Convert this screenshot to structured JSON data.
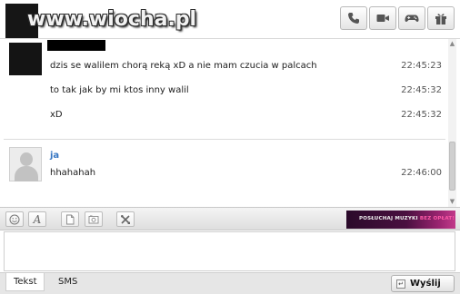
{
  "watermark": "www.wiocha.pl",
  "conversation": {
    "messages_other": [
      {
        "text": "dzis se walilem chorą reką xD a nie mam czucia w palcach",
        "time": "22:45:23"
      },
      {
        "text": "to tak jak by mi ktos inny walil",
        "time": "22:45:32"
      },
      {
        "text": "xD",
        "time": "22:45:32"
      }
    ],
    "me": {
      "name": "ja",
      "message": {
        "text": "hhahahah",
        "time": "22:46:00"
      }
    }
  },
  "toolbar": {
    "banner_text": "POSŁUCHAJ MUZYKI",
    "banner_highlight": "BEZ OPŁAT!"
  },
  "input": {
    "placeholder": "",
    "value": ""
  },
  "tabs": {
    "text": "Tekst",
    "sms": "SMS"
  },
  "send_label": "Wyślij",
  "icons": [
    "phone-icon",
    "video-icon",
    "gamepad-icon",
    "gift-icon",
    "smiley-icon",
    "font-icon",
    "file-icon",
    "image-icon",
    "tools-icon",
    "send-icon"
  ],
  "colors": {
    "me_name": "#3575c2",
    "banner_highlight": "#ff5aa8"
  }
}
